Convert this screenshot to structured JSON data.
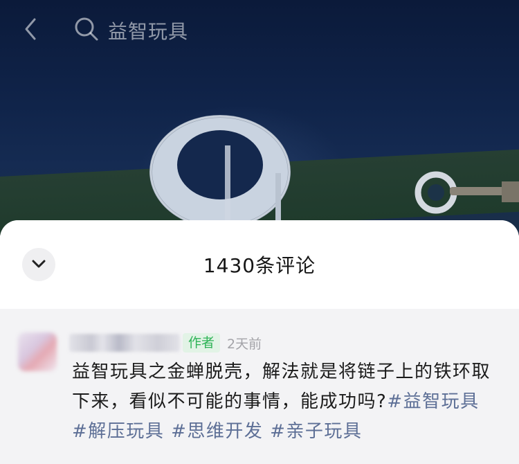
{
  "search": {
    "query": "益智玩具"
  },
  "sheet": {
    "title": "1430条评论"
  },
  "comment": {
    "author_badge": "作者",
    "time": "2天前",
    "text": "益智玩具之金蝉脱壳，解法就是将链子上的铁环取下来，看似不可能的事情，能成功吗?",
    "hashtags": [
      "#益智玩具",
      "#解压玩具",
      "#思维开发",
      "#亲子玩具"
    ]
  },
  "colors": {
    "author_badge_bg": "#e2f3e6",
    "author_badge_text": "#2fb357",
    "hashtag": "#5d6f96",
    "video_bg": "#10244a"
  },
  "icons": [
    "back-arrow-icon",
    "search-icon",
    "chevron-down-icon"
  ]
}
